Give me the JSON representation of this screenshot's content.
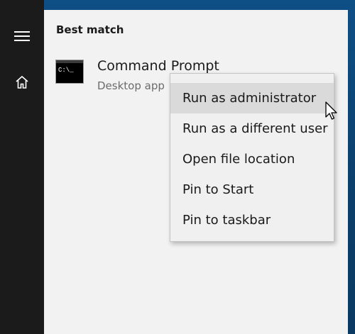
{
  "start_rail": {
    "items": [
      {
        "name": "menu",
        "icon": "hamburger-icon"
      },
      {
        "name": "home",
        "icon": "home-icon"
      }
    ]
  },
  "results": {
    "section_header": "Best match",
    "best_match": {
      "title": "Command Prompt",
      "subtitle": "Desktop app",
      "icon": "command-prompt-icon",
      "icon_text": "C:\\_"
    }
  },
  "context_menu": {
    "items": [
      {
        "label": "Run as administrator",
        "highlighted": true
      },
      {
        "label": "Run as a different user",
        "highlighted": false
      },
      {
        "label": "Open file location",
        "highlighted": false
      },
      {
        "label": "Pin to Start",
        "highlighted": false
      },
      {
        "label": "Pin to taskbar",
        "highlighted": false
      }
    ]
  },
  "colors": {
    "rail_bg": "#1b1b1b",
    "panel_bg": "#f2f2f2",
    "menu_bg": "#f0f0f0",
    "menu_highlight": "#dadada",
    "desktop_bg": "#0c3f6b"
  }
}
